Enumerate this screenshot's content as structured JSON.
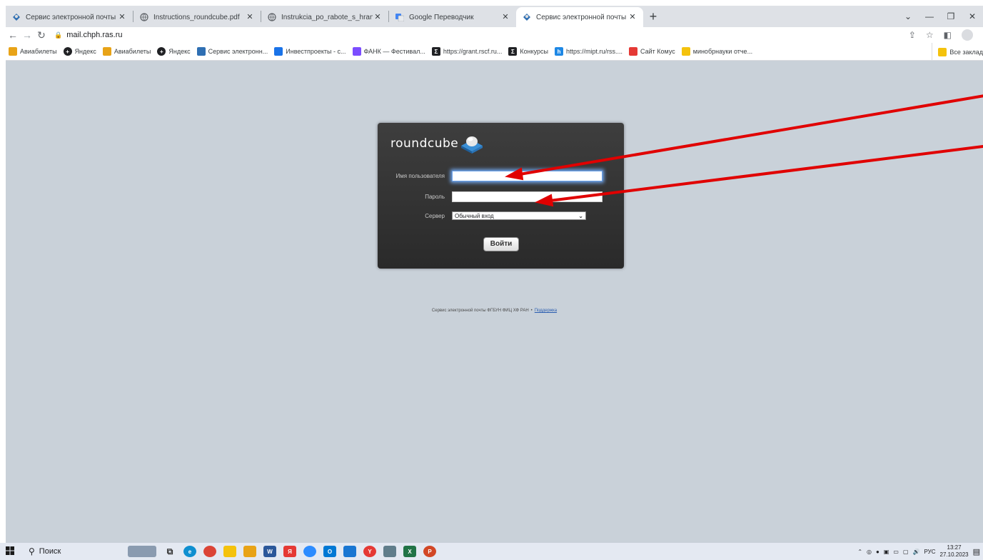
{
  "tabs": [
    {
      "title": "Сервис электронной почты Ф",
      "icon": "roundcube-icon",
      "active": false
    },
    {
      "title": "Instructions_roundcube.pdf",
      "icon": "globe-icon",
      "active": false
    },
    {
      "title": "Instrukcia_po_rabote_s_hranilish",
      "icon": "globe-icon",
      "active": false
    },
    {
      "title": "Google Переводчик",
      "icon": "google-translate-icon",
      "active": false
    },
    {
      "title": "Сервис электронной почты Ф",
      "icon": "roundcube-icon",
      "active": true
    }
  ],
  "toolbar": {
    "url": "mail.chph.ras.ru"
  },
  "bookmarks": [
    {
      "label": "Авиабилеты",
      "color": "#e8a317"
    },
    {
      "label": "Яндекс",
      "color": "#202124"
    },
    {
      "label": "Авиабилеты",
      "color": "#e8a317"
    },
    {
      "label": "Яндекс",
      "color": "#202124"
    },
    {
      "label": "Сервис электронн...",
      "color": "#2f6fb3"
    },
    {
      "label": "Инвестпроекты - с...",
      "color": "#1a73e8"
    },
    {
      "label": "ФАНК — Фестивал...",
      "color": "#7c4dff"
    },
    {
      "label": "https://grant.rscf.ru...",
      "color": "#202124"
    },
    {
      "label": "Конкурсы",
      "color": "#202124"
    },
    {
      "label": "https://mipt.ru/rss....",
      "color": "#1e88e5"
    },
    {
      "label": "Сайт Комус",
      "color": "#e53935"
    },
    {
      "label": "минобрнауки отче...",
      "color": "#f4c20d"
    }
  ],
  "bookmarks_all": "Все заклад",
  "login": {
    "logo_text": "roundcube",
    "username_label": "Имя пользователя",
    "username_value": "",
    "password_label": "Пароль",
    "password_value": "",
    "server_label": "Сервер",
    "server_value": "Обычный вход",
    "submit_label": "Войти"
  },
  "footer": {
    "text": "Сервис электронной почты ФГБУН ФИЦ ХФ РАН",
    "separator": "•",
    "support_link": "Поддержка"
  },
  "taskbar": {
    "search_label": "Поиск",
    "language": "РУС",
    "time": "13:27",
    "date": "27.10.2023"
  },
  "colors": {
    "page_background": "#c9d1d9",
    "login_box": "#333333",
    "arrow": "#e00000",
    "focus_glow": "#71a7ee"
  }
}
